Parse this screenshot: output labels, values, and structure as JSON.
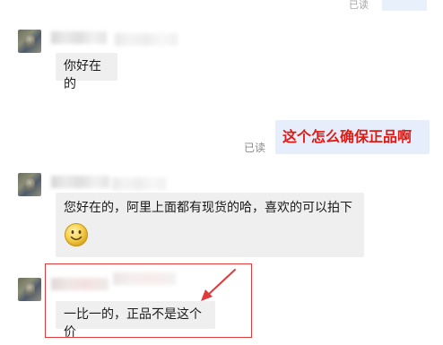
{
  "top": {
    "read_label": "已读"
  },
  "messages": [
    {
      "side": "left",
      "text": "你好在的"
    },
    {
      "side": "right",
      "text": "这个怎么确保正品啊",
      "read_label": "已读",
      "text_color": "#e11b14"
    },
    {
      "side": "left",
      "text": "您好在的，阿里上面都有现货的哈，喜欢的可以拍下",
      "emoji": "smile-face"
    },
    {
      "side": "left",
      "text": "一比一的，正品不是这个价",
      "highlighted": true,
      "highlight_color": "#e03a3a"
    }
  ]
}
